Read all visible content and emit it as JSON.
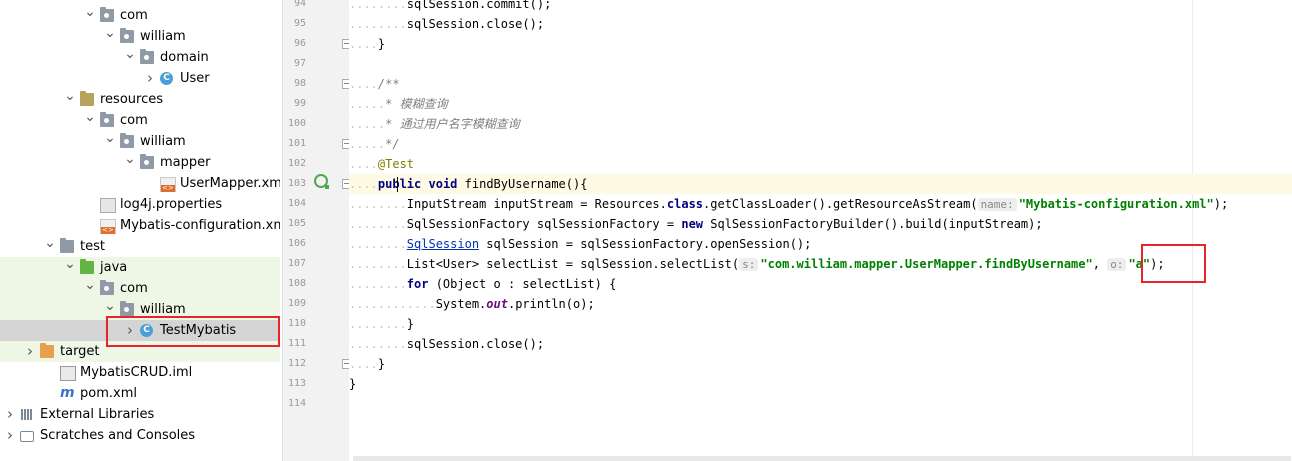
{
  "tree": [
    {
      "name": "tree-package-com",
      "indent": 84,
      "arrow": "v",
      "icon": "folder pkg",
      "label": "com",
      "sel": false
    },
    {
      "name": "tree-package-william",
      "indent": 104,
      "arrow": "v",
      "icon": "folder pkg",
      "label": "william",
      "sel": false
    },
    {
      "name": "tree-package-domain",
      "indent": 124,
      "arrow": "v",
      "icon": "folder pkg",
      "label": "domain",
      "sel": false
    },
    {
      "name": "tree-class-user",
      "indent": 144,
      "arrow": ">",
      "icon": "class",
      "label": "User",
      "sel": false
    },
    {
      "name": "tree-folder-resources",
      "indent": 64,
      "arrow": "v",
      "icon": "folder res",
      "label": "resources",
      "sel": false
    },
    {
      "name": "tree-package-com-res",
      "indent": 84,
      "arrow": "v",
      "icon": "folder pkg",
      "label": "com",
      "sel": false
    },
    {
      "name": "tree-package-william-res",
      "indent": 104,
      "arrow": "v",
      "icon": "folder pkg",
      "label": "william",
      "sel": false
    },
    {
      "name": "tree-package-mapper",
      "indent": 124,
      "arrow": "v",
      "icon": "folder pkg",
      "label": "mapper",
      "sel": false
    },
    {
      "name": "tree-file-usermapper-xml",
      "indent": 144,
      "arrow": "",
      "icon": "xml",
      "label": "UserMapper.xml",
      "sel": false
    },
    {
      "name": "tree-file-log4j",
      "indent": 84,
      "arrow": "",
      "icon": "prop",
      "label": "log4j.properties",
      "sel": false
    },
    {
      "name": "tree-file-mybatis-config",
      "indent": 84,
      "arrow": "",
      "icon": "xml",
      "label": "Mybatis-configuration.xml",
      "sel": false
    },
    {
      "name": "tree-folder-test",
      "indent": 44,
      "arrow": "v",
      "icon": "folder",
      "label": "test",
      "sel": false
    },
    {
      "name": "tree-folder-java",
      "indent": 64,
      "arrow": "v",
      "icon": "folder java",
      "label": "java",
      "sel": false,
      "green": true
    },
    {
      "name": "tree-package-com-test",
      "indent": 84,
      "arrow": "v",
      "icon": "folder pkg",
      "label": "com",
      "sel": false,
      "green": true
    },
    {
      "name": "tree-package-william-test",
      "indent": 104,
      "arrow": "v",
      "icon": "folder pkg",
      "label": "william",
      "sel": false,
      "green": true
    },
    {
      "name": "tree-class-testmybatis",
      "indent": 124,
      "arrow": ">",
      "icon": "class",
      "label": "TestMybatis",
      "sel": true
    },
    {
      "name": "tree-folder-target",
      "indent": 24,
      "arrow": ">",
      "icon": "folder target",
      "label": "target",
      "sel": false,
      "green": true
    },
    {
      "name": "tree-file-mybatiscrud-iml",
      "indent": 44,
      "arrow": "",
      "icon": "iml",
      "label": "MybatisCRUD.iml",
      "sel": false
    },
    {
      "name": "tree-file-pom-xml",
      "indent": 44,
      "arrow": "",
      "icon": "mvn",
      "label": "pom.xml",
      "sel": false
    },
    {
      "name": "tree-external-libraries",
      "indent": 4,
      "arrow": ">",
      "icon": "lib",
      "label": "External Libraries",
      "sel": false
    },
    {
      "name": "tree-scratches-consoles",
      "indent": 4,
      "arrow": ">",
      "icon": "scr",
      "label": "Scratches and Consoles",
      "sel": false
    }
  ],
  "line_numbers": [
    "94",
    "95",
    "96",
    "97",
    "98",
    "99",
    "100",
    "101",
    "102",
    "103",
    "104",
    "105",
    "106",
    "107",
    "108",
    "109",
    "110",
    "111",
    "112",
    "113",
    "114"
  ],
  "code": {
    "l94_text": "sqlSession.commit();",
    "l95_text": "sqlSession.close();",
    "l96_text": "}",
    "l98_text": "/**",
    "l99_star": "* ",
    "l99_cjk": "模糊查询",
    "l100_star": "* ",
    "l100_cjk": "通过用户名字模糊查询",
    "l101_text": "*/",
    "l102_ann": "@Test",
    "l103_kw1": "public",
    "l103_kw2": "void",
    "l103_rest": "findByUsername(){",
    "l104_a": "InputStream inputStream = Resources.",
    "l104_kw": "class",
    "l104_b": ".getClassLoader().getResourceAsStream(",
    "l104_hint": "name:",
    "l104_str": "\"Mybatis-configuration.xml\"",
    "l104_c": ");",
    "l105_a": "SqlSessionFactory sqlSessionFactory = ",
    "l105_kw": "new",
    "l105_b": " SqlSessionFactoryBuilder().build(inputStream);",
    "l106_ul": "SqlSession",
    "l106_b": " sqlSession = sqlSessionFactory.openSession();",
    "l107_a": "List<User> selectList = sqlSession.selectList(",
    "l107_hint1": "s:",
    "l107_str1": "\"com.william.mapper.UserMapper.findByUsername\"",
    "l107_comma": ", ",
    "l107_hint2": "o:",
    "l107_str2": "\"a\"",
    "l107_c": ");",
    "l108_kw": "for",
    "l108_b": " (Object o : selectList) {",
    "l109_a": "System.",
    "l109_static": "out",
    "l109_b": ".println(o);",
    "l110_text": "}",
    "l111_text": "sqlSession.close();",
    "l112_text": "}",
    "l113_text": "}"
  }
}
